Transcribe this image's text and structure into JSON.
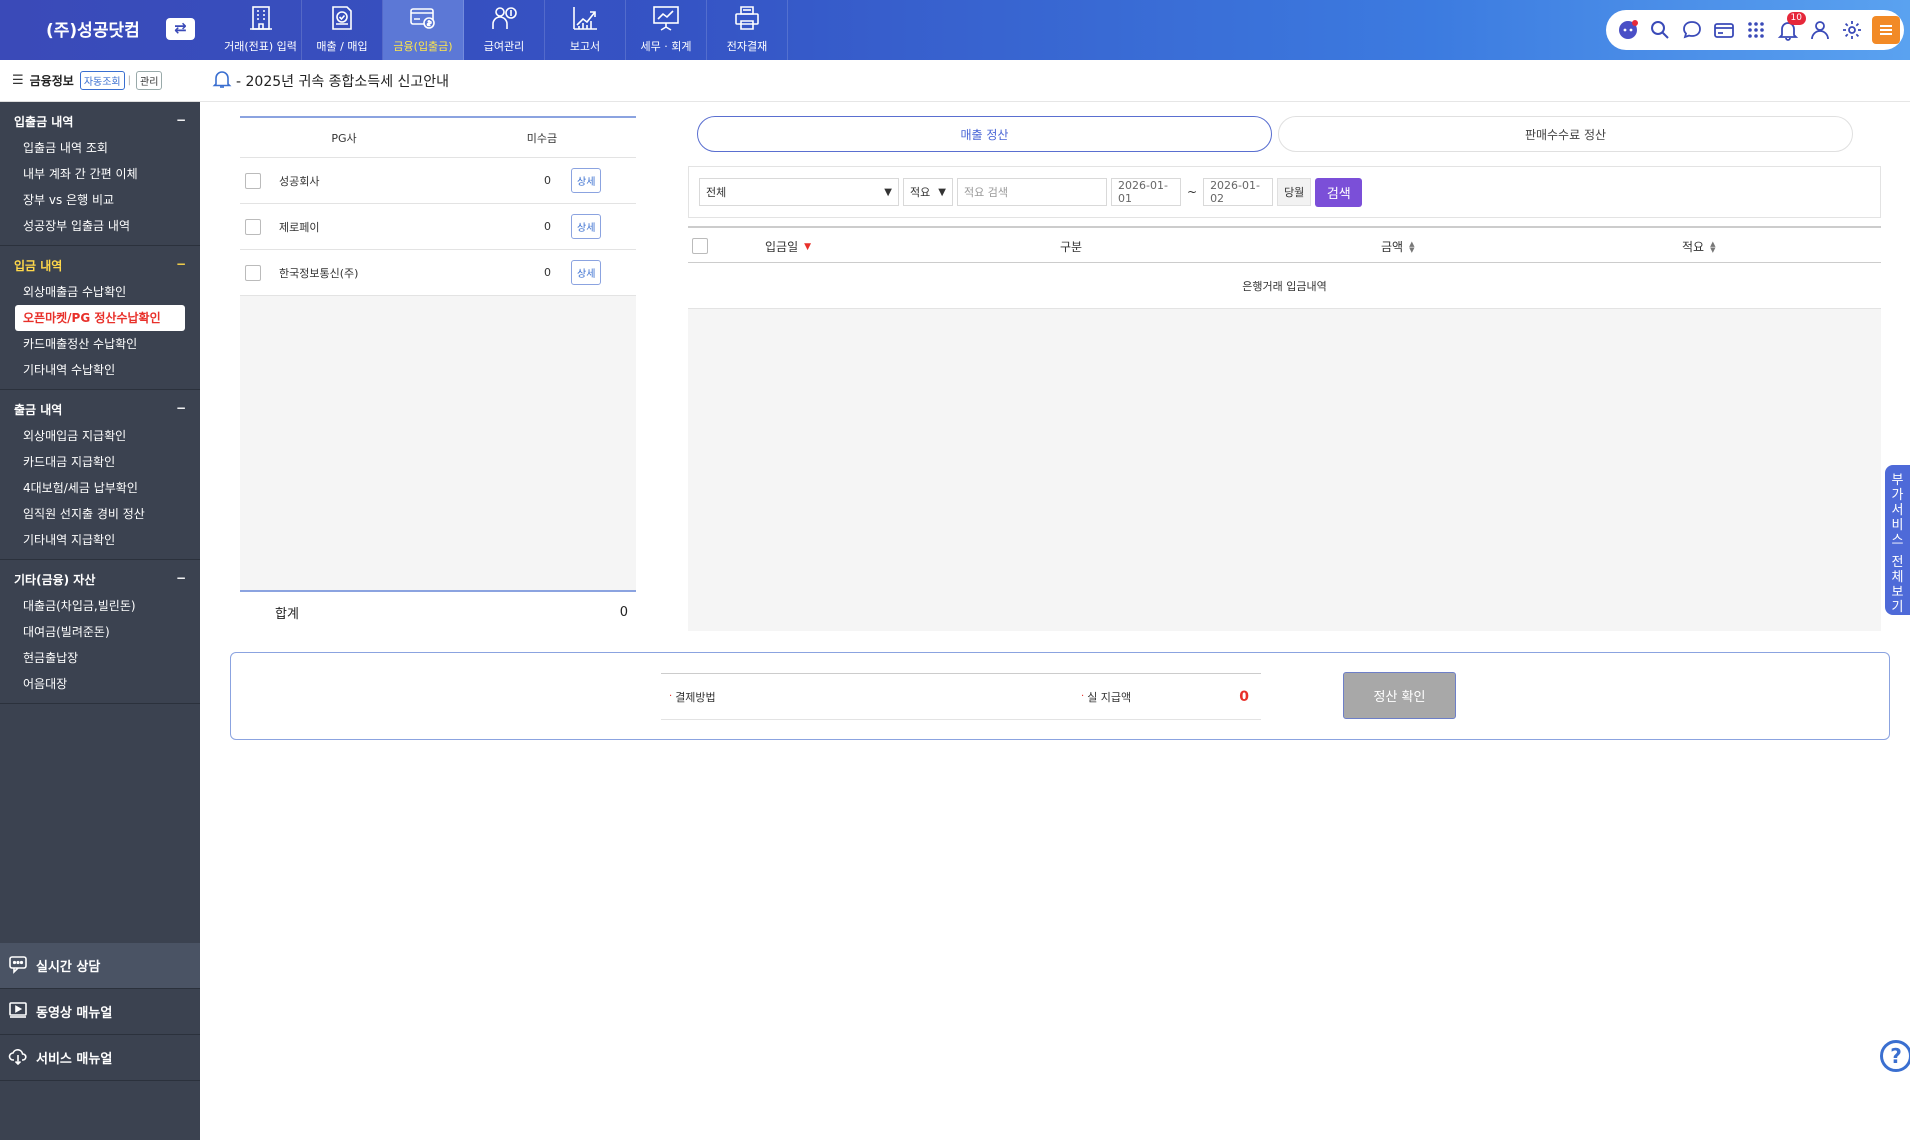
{
  "header": {
    "company": "(주)성공닷컴",
    "switch_icon": "⇄",
    "nav": [
      {
        "label": "거래(전표) 입력",
        "icon": "building-icon"
      },
      {
        "label": "매출 / 매입",
        "icon": "document-check-icon"
      },
      {
        "label": "금융(입출금)",
        "icon": "card-money-icon"
      },
      {
        "label": "급여관리",
        "icon": "person-money-icon"
      },
      {
        "label": "보고서",
        "icon": "chart-up-icon"
      },
      {
        "label": "세무 · 회계",
        "icon": "presentation-icon"
      },
      {
        "label": "전자결재",
        "icon": "printer-icon"
      }
    ],
    "active_nav_index": 2,
    "notification_count": "10",
    "util_icons": [
      "chatbot-icon",
      "search-icon",
      "chat-icon",
      "card-icon",
      "apps-grid-icon",
      "bell-icon",
      "user-icon",
      "settings-icon",
      "hamburger-menu-icon"
    ]
  },
  "sidebar": {
    "title": "금융정보",
    "auto_btn": "자동조회",
    "manage_btn": "관리",
    "separator": "|",
    "collapse_symbol": "−",
    "sections": [
      {
        "title": "입출금 내역",
        "highlight": false,
        "items": [
          "입출금 내역 조회",
          "내부 계좌 간 간편 이체",
          "장부 vs 은행 비교",
          "성공장부 입출금 내역"
        ]
      },
      {
        "title": "입금 내역",
        "highlight": true,
        "items": [
          "외상매출금 수납확인",
          "오픈마켓/PG 정산수납확인",
          "카드매출정산 수납확인",
          "기타내역 수납확인"
        ]
      },
      {
        "title": "출금 내역",
        "highlight": false,
        "items": [
          "외상매입금 지급확인",
          "카드대금 지급확인",
          "4대보험/세금 납부확인",
          "임직원 선지출 경비 정산",
          "기타내역 지급확인"
        ]
      },
      {
        "title": "기타(금융) 자산",
        "highlight": false,
        "items": [
          "대출금(차입금,빌린돈)",
          "대여금(빌려준돈)",
          "현금출납장",
          "어음대장"
        ]
      }
    ],
    "active_item": "오픈마켓/PG 정산수납확인",
    "bottom": [
      {
        "label": "실시간 상담",
        "icon": "chat-support-icon"
      },
      {
        "label": "동영상 매뉴얼",
        "icon": "video-icon"
      },
      {
        "label": "서비스 매뉴얼",
        "icon": "cloud-download-icon"
      }
    ]
  },
  "notice": "- 2025년 귀속 종합소득세 신고안내",
  "pg_table": {
    "col_pg": "PG사",
    "col_unpaid": "미수금",
    "detail_label": "상세",
    "rows": [
      {
        "name": "성공회사",
        "amount": "0"
      },
      {
        "name": "제로페이",
        "amount": "0"
      },
      {
        "name": "한국정보통신(주)",
        "amount": "0"
      }
    ],
    "total_label": "합계",
    "total_value": "0"
  },
  "tabs": [
    {
      "label": "매출 정산",
      "active": true
    },
    {
      "label": "판매수수료 정산",
      "active": false
    }
  ],
  "filter": {
    "category": "전체",
    "field": "적요",
    "search_placeholder": "적요 검색",
    "date_from": "2026-01-01",
    "date_sep": "~",
    "date_to": "2026-01-02",
    "month_btn": "당월",
    "search_btn": "검색"
  },
  "txn_table": {
    "columns": [
      "입금일",
      "구분",
      "금액",
      "적요"
    ],
    "sort_down_glyph": "▼",
    "sort_up_glyph": "▲",
    "sort_dn_glyph": "▼",
    "empty_text": "은행거래 입금내역"
  },
  "settlement": {
    "method_label": "결제방법",
    "paid_label": "실 지급액",
    "bullet": "·",
    "amount": "0",
    "confirm_btn": "정산 확인"
  },
  "side_tab": {
    "chars": [
      "부",
      "가",
      "서",
      "비",
      "스",
      "",
      "전",
      "체",
      "보",
      "기"
    ]
  },
  "help_glyph": "?",
  "colors": {
    "accent": "#3a4ab8",
    "active_nav_text": "#ffe74a",
    "sidebar_bg": "#3b4250",
    "active_item": "#e8302a",
    "search_btn": "#7b4fd8",
    "settle_amount": "#e8302a"
  }
}
